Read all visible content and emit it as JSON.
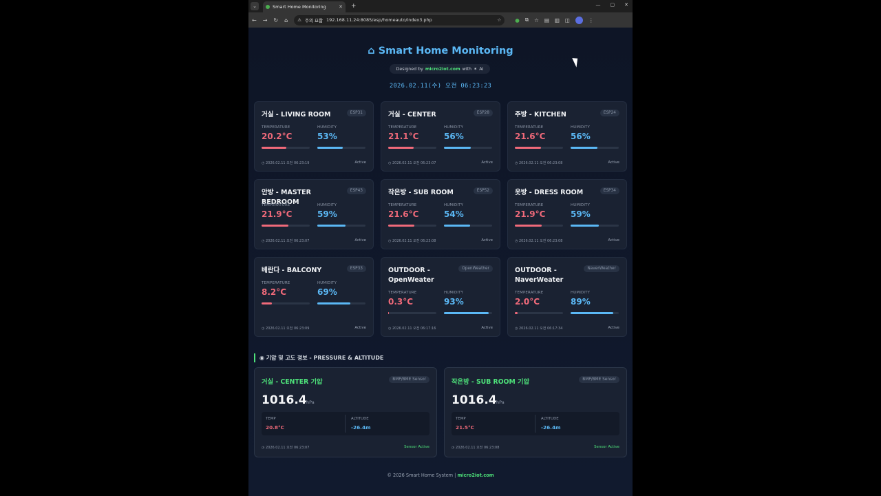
{
  "browser": {
    "tab_title": "Smart Home Monitoring",
    "new_tab": "+",
    "url_warning": "주의 요함",
    "url": "192.168.11.24:8085/esp/homeauto/index3.php"
  },
  "header": {
    "title": "Smart Home Monitoring",
    "designed_prefix": "Designed by",
    "designed_brand": "micro2iot.com",
    "designed_suffix": "with",
    "designed_ai": "AI",
    "datetime": "2026.02.11(수) 오전 06:23:23"
  },
  "labels": {
    "temperature": "TEMPERATURE",
    "humidity": "HUMIDITY",
    "active": "Active",
    "temp": "TEMP",
    "altitude": "ALTITUDE",
    "unit": "hPa",
    "sensor_active": "Sensor Active"
  },
  "rooms": [
    {
      "name": "거실 - LIVING ROOM",
      "badge": "ESP31",
      "temp": "20.2°C",
      "temp_level": 0.51,
      "hum": "53%",
      "hum_level": 0.53,
      "time": "2026.02.11 오전 06:23:19"
    },
    {
      "name": "거실 - CENTER",
      "badge": "ESP28",
      "temp": "21.1°C",
      "temp_level": 0.53,
      "hum": "56%",
      "hum_level": 0.56,
      "time": "2026.02.11 오전 06:23:07"
    },
    {
      "name": "주방 - KITCHEN",
      "badge": "ESP24",
      "temp": "21.6°C",
      "temp_level": 0.54,
      "hum": "56%",
      "hum_level": 0.56,
      "time": "2026.02.11 오전 06:23:08"
    },
    {
      "name": "안방 - MASTER BEDROOM",
      "badge": "ESP43",
      "temp": "21.9°C",
      "temp_level": 0.55,
      "hum": "59%",
      "hum_level": 0.59,
      "time": "2026.02.11 오전 06:23:07"
    },
    {
      "name": "작은방 - SUB ROOM",
      "badge": "ESP52",
      "temp": "21.6°C",
      "temp_level": 0.54,
      "hum": "54%",
      "hum_level": 0.54,
      "time": "2026.02.11 오전 06:23:08"
    },
    {
      "name": "옷방 - DRESS ROOM",
      "badge": "ESP34",
      "temp": "21.9°C",
      "temp_level": 0.55,
      "hum": "59%",
      "hum_level": 0.59,
      "time": "2026.02.11 오전 06:23:08"
    },
    {
      "name": "베란다 - BALCONY",
      "badge": "ESP33",
      "temp": "8.2°C",
      "temp_level": 0.21,
      "hum": "69%",
      "hum_level": 0.69,
      "time": "2026.02.11 오전 06:23:09"
    },
    {
      "name": "OUTDOOR - OpenWeater",
      "badge": "OpenWeather",
      "temp": "0.3°C",
      "temp_level": 0.01,
      "hum": "93%",
      "hum_level": 0.93,
      "time": "2026.02.11 오전 06:17:16"
    },
    {
      "name": "OUTDOOR - NaverWeater",
      "badge": "NaverWeather",
      "temp": "2.0°C",
      "temp_level": 0.05,
      "hum": "89%",
      "hum_level": 0.89,
      "time": "2026.02.11 오전 06:17:34"
    }
  ],
  "pressure_section": {
    "title": "기압 및 고도 정보 - PRESSURE & ALTITUDE",
    "cards": [
      {
        "name": "거실 - CENTER 기압",
        "badge": "BMP/BME Sensor",
        "value": "1016.4",
        "temp": "20.8°C",
        "altitude": "-26.4m",
        "time": "2026.02.11 오전 06:23:07"
      },
      {
        "name": "작은방 - SUB ROOM 기압",
        "badge": "BMP/BME Sensor",
        "value": "1016.4",
        "temp": "21.5°C",
        "altitude": "-26.4m",
        "time": "2026.02.11 오전 06:23:08"
      }
    ]
  },
  "footer": {
    "text": "© 2026 Smart Home System |",
    "brand": "micro2iot.com"
  }
}
